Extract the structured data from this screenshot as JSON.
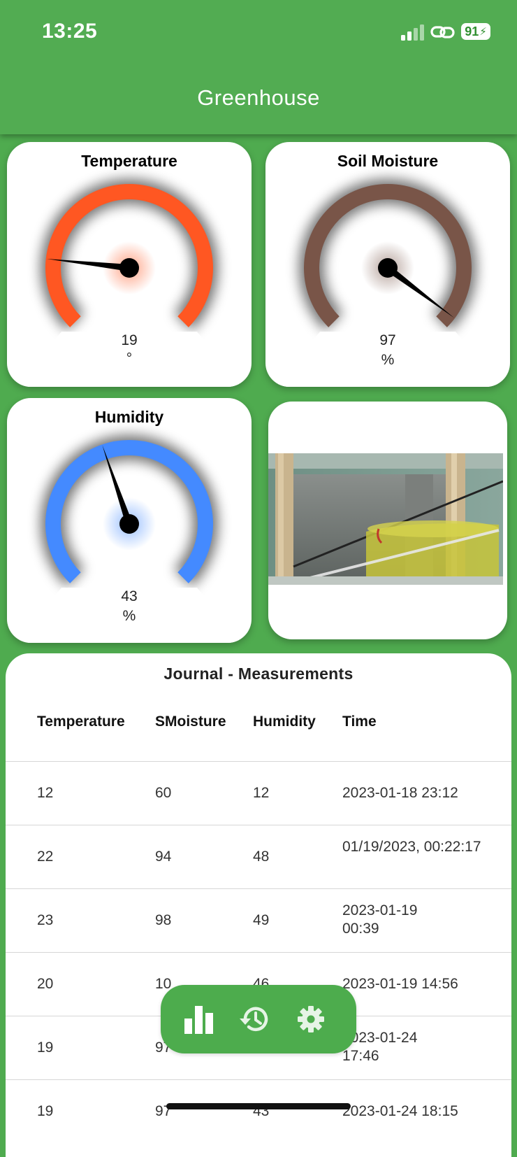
{
  "status_bar": {
    "time": "13:25",
    "battery": "91"
  },
  "app_bar": {
    "title": "Greenhouse"
  },
  "gauges": [
    {
      "title": "Temperature",
      "value": "19",
      "unit": "°",
      "color": "#ff5722",
      "level": 0.19
    },
    {
      "title": "Soil Moisture",
      "value": "97",
      "unit": "%",
      "color": "#795548",
      "level": 0.97
    },
    {
      "title": "Humidity",
      "value": "43",
      "unit": "%",
      "color": "#448aff",
      "level": 0.43
    }
  ],
  "camera": {
    "icon": "camera-feed-image"
  },
  "journal": {
    "title": "Journal - Measurements",
    "headers": [
      "Temperature",
      "SMoisture",
      "Humidity",
      "Time"
    ],
    "rows": [
      {
        "temperature": "12",
        "smoisture": "60",
        "humidity": "12",
        "time": "2023-01-18 23:12"
      },
      {
        "temperature": "22",
        "smoisture": "94",
        "humidity": "48",
        "time": "01/19/2023, 00:22:17"
      },
      {
        "temperature": "23",
        "smoisture": "98",
        "humidity": "49",
        "time": "2023-01-19 00:39"
      },
      {
        "temperature": "20",
        "smoisture": "10",
        "humidity": "46",
        "time": "2023-01-19 14:56"
      },
      {
        "temperature": "19",
        "smoisture": "97",
        "humidity": "47",
        "time": "2023-01-24 17:46"
      },
      {
        "temperature": "19",
        "smoisture": "97",
        "humidity": "43",
        "time": "2023-01-24 18:15"
      }
    ]
  },
  "bottom_nav": {
    "items": [
      {
        "icon": "bar-chart-icon",
        "active": true
      },
      {
        "icon": "history-icon",
        "active": false
      },
      {
        "icon": "gear-icon",
        "active": false
      }
    ]
  },
  "colors": {
    "primary": "#4fab4f",
    "white": "#ffffff"
  }
}
